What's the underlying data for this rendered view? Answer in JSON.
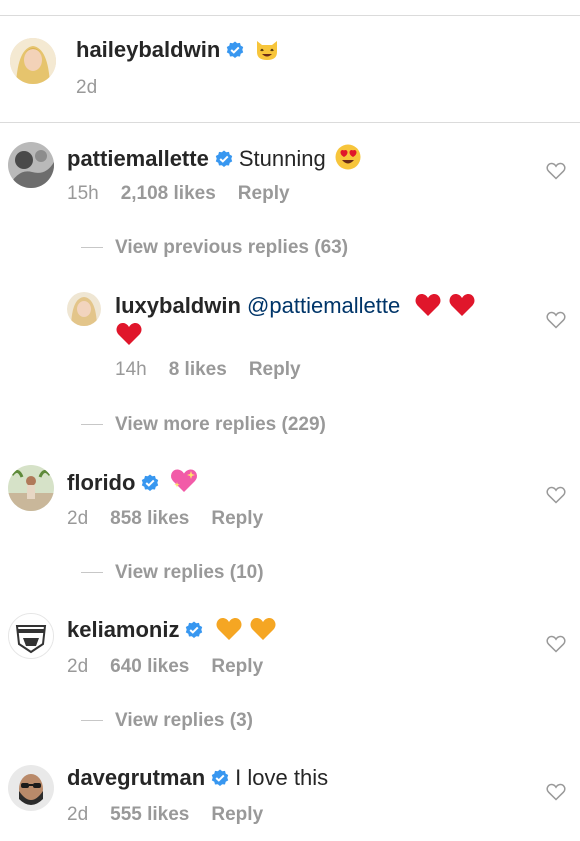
{
  "post": {
    "username": "haileybaldwin",
    "caption_emoji": "cat-smile-emoji",
    "time": "2d"
  },
  "comments": [
    {
      "username": "pattiemallette",
      "text": "Stunning",
      "emoji": "heart-eyes-emoji",
      "time": "15h",
      "likes": "2,108 likes",
      "reply": "Reply",
      "view_replies": "View previous replies (63)"
    },
    {
      "username": "luxybaldwin",
      "mention": "@pattiemallette",
      "emoji": "red-heart-emoji",
      "time": "14h",
      "likes": "8 likes",
      "reply": "Reply",
      "view_replies": "View more replies (229)"
    },
    {
      "username": "florido",
      "emoji": "sparkling-heart-emoji",
      "time": "2d",
      "likes": "858 likes",
      "reply": "Reply",
      "view_replies": "View replies (10)"
    },
    {
      "username": "keliamoniz",
      "emoji": "orange-heart-emoji",
      "time": "2d",
      "likes": "640 likes",
      "reply": "Reply",
      "view_replies": "View replies (3)"
    },
    {
      "username": "davegrutman",
      "text": "I love this",
      "time": "2d",
      "likes": "555 likes",
      "reply": "Reply"
    }
  ],
  "colors": {
    "verified": "#3897f0",
    "muted": "#999999",
    "heart_red": "#e0162b",
    "heart_orange": "#f5a623"
  }
}
